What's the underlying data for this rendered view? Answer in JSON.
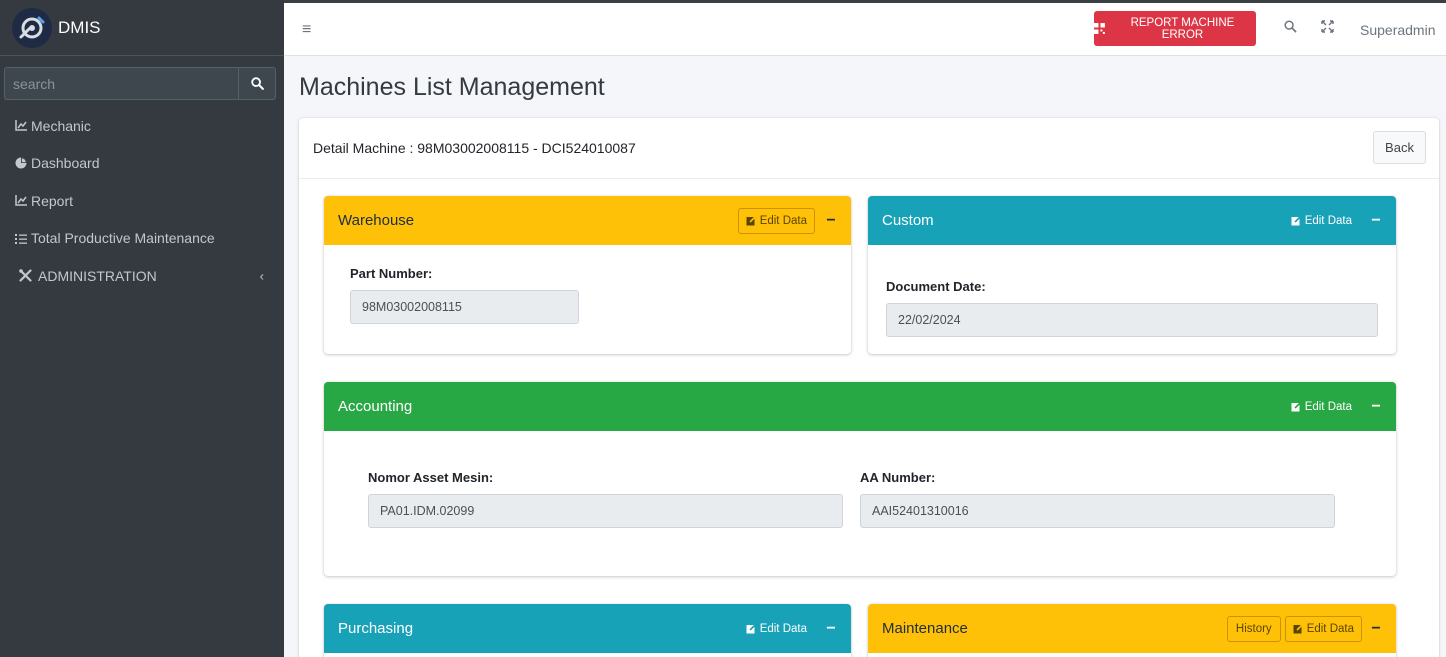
{
  "brand": {
    "name": "DMIS"
  },
  "sidebar": {
    "search_placeholder": "search",
    "items": [
      {
        "label": "Mechanic",
        "icon": "chart-line-icon"
      },
      {
        "label": "Dashboard",
        "icon": "pie-chart-icon"
      },
      {
        "label": "Report",
        "icon": "chart-line-icon"
      },
      {
        "label": "Total Productive Maintenance",
        "icon": "list-icon"
      },
      {
        "label": "ADMINISTRATION",
        "icon": "tools-icon"
      }
    ]
  },
  "topbar": {
    "report_button": "REPORT MACHINE ERROR",
    "user": "Superadmin"
  },
  "page": {
    "title": "Machines List Management",
    "detail_title": "Detail Machine : 98M03002008115 - DCI524010087",
    "back_button": "Back"
  },
  "panels": {
    "warehouse": {
      "title": "Warehouse",
      "edit": "Edit Data",
      "fields": [
        {
          "label": "Part Number:",
          "value": "98M03002008115"
        }
      ]
    },
    "custom": {
      "title": "Custom",
      "edit": "Edit Data",
      "fields": [
        {
          "label": "Document Date:",
          "value": "22/02/2024"
        }
      ]
    },
    "accounting": {
      "title": "Accounting",
      "edit": "Edit Data",
      "fields": [
        {
          "label": "Nomor Asset Mesin:",
          "value": "PA01.IDM.02099"
        },
        {
          "label": "AA Number:",
          "value": "AAI52401310016"
        }
      ]
    },
    "purchasing": {
      "title": "Purchasing",
      "edit": "Edit Data"
    },
    "maintenance": {
      "title": "Maintenance",
      "edit": "Edit Data",
      "history": "History"
    }
  },
  "colors": {
    "sidebar": "#343a40",
    "warning": "#ffc107",
    "info": "#17a2b8",
    "success": "#28a745",
    "danger": "#dc3545"
  }
}
